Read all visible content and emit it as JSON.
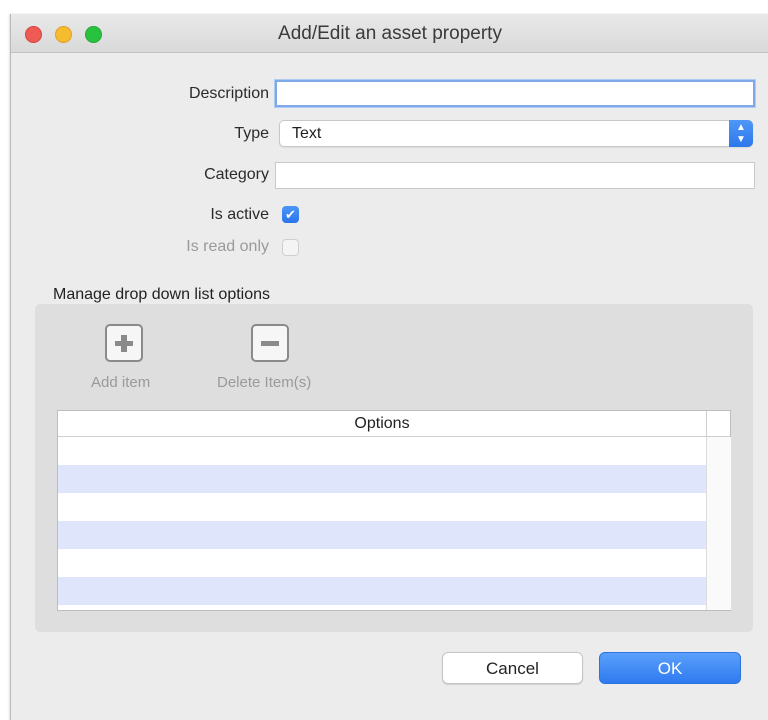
{
  "window": {
    "title": "Add/Edit an asset property"
  },
  "form": {
    "description_label": "Description",
    "description_value": "",
    "type_label": "Type",
    "type_value": "Text",
    "category_label": "Category",
    "category_value": "",
    "is_active_label": "Is active",
    "is_active_checked": true,
    "is_read_only_label": "Is read only",
    "is_read_only_checked": false
  },
  "dropdown_options": {
    "section_title": "Manage drop down list options",
    "add_label": "Add item",
    "delete_label": "Delete Item(s)",
    "table_header": "Options",
    "rows": [
      "",
      "",
      "",
      "",
      "",
      ""
    ]
  },
  "buttons": {
    "cancel": "Cancel",
    "ok": "OK"
  },
  "colors": {
    "accent": "#3b84f4",
    "row_alt": "#dfe6fb",
    "panel_bg": "#dedede"
  }
}
